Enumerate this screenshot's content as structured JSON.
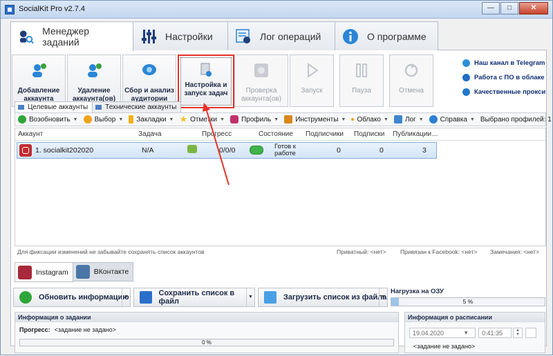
{
  "window": {
    "title": "SocialKit Pro v2.7.4",
    "minimize": "—",
    "maximize": "□",
    "close": "✕"
  },
  "main_tabs": [
    {
      "label": "Менеджер заданий",
      "icon": "user-search-icon"
    },
    {
      "label": "Настройки",
      "icon": "sliders-icon"
    },
    {
      "label": "Лог операций",
      "icon": "log-icon"
    },
    {
      "label": "О программе",
      "icon": "info-icon"
    }
  ],
  "ribbon": [
    {
      "label": "Добавление\nаккаунта",
      "icon": "add-user-icon"
    },
    {
      "label": "Удаление\nаккаунта(ов)",
      "icon": "remove-user-icon"
    },
    {
      "label": "Сбор и анализ\nаудитории",
      "icon": "audience-icon"
    },
    {
      "label": "Настройка и\nзапуск задач",
      "icon": "task-settings-icon"
    },
    {
      "label": "Проверка\nаккаунта(ов)",
      "icon": "check-account-icon"
    },
    {
      "label": "Запуск",
      "icon": "play-icon"
    },
    {
      "label": "Пауза",
      "icon": "pause-icon"
    },
    {
      "label": "Отмена",
      "icon": "cancel-icon"
    }
  ],
  "side_links": [
    {
      "label": "Наш канал в Telegram",
      "color": "#2a8fd6"
    },
    {
      "label": "Работа с ПО в облаке",
      "color": "#1f6fc4"
    },
    {
      "label": "Качественные прокси",
      "color": "#2478c8"
    }
  ],
  "sub_tabs": [
    "Целевые аккаунты",
    "Технические аккаунты"
  ],
  "toolbar": [
    {
      "label": "Возобновить",
      "color": "#2fa53a"
    },
    {
      "label": "Выбор",
      "color": "#f0a21e"
    },
    {
      "label": "Закладки",
      "color": "#f2b01e"
    },
    {
      "label": "Отметки",
      "color": "#f5c021"
    },
    {
      "label": "Профиль",
      "color": "#c2306c"
    },
    {
      "label": "Инструменты",
      "color": "#d9881c"
    },
    {
      "label": "Облако",
      "color": "#f0a21e"
    },
    {
      "label": "Лог",
      "color": "#3f86cf"
    },
    {
      "label": "Справка",
      "color": "#2d7fd3"
    }
  ],
  "selected_count": "Выбрано профилей: 1",
  "grid": {
    "headers": [
      "Аккаунт",
      "Задача",
      "Прогресс",
      "Состояние",
      "Подписчики",
      "Подписки",
      "Публикации"
    ],
    "more": "...",
    "row": {
      "account": "1. socialkit202020",
      "task": "N/A",
      "progress": "0/0/0",
      "state": "Готов к\nработе",
      "followers": "0",
      "following": "0",
      "posts": "3"
    }
  },
  "grid_status": {
    "hint": "Для фиксации изменений не забывайте сохранять список аккаунтов",
    "private": "Приватный: <нет>",
    "facebook": "Привязан к Facebook: <нет>",
    "notes": "Замечания: <нет>"
  },
  "platform_tabs": [
    {
      "label": "Instagram",
      "color": "#a8293a"
    },
    {
      "label": "ВКонтакте",
      "color": "#4a76a8"
    }
  ],
  "actions": {
    "refresh": "Обновить информацию",
    "save": "Сохранить список в файл",
    "load": "Загрузить список из файла"
  },
  "ram": {
    "label": "Нагрузка на ОЗУ",
    "value": "5 %",
    "fraction": 0.05
  },
  "task_info": {
    "title": "Информация о задании",
    "progress_label": "Прогресс:",
    "progress_value": "<задание не задано>",
    "percent": "0 %"
  },
  "schedule": {
    "title": "Информация о расписании",
    "date": "19.04.2020",
    "time": "0:41:35",
    "note": "<задание не задано>"
  }
}
